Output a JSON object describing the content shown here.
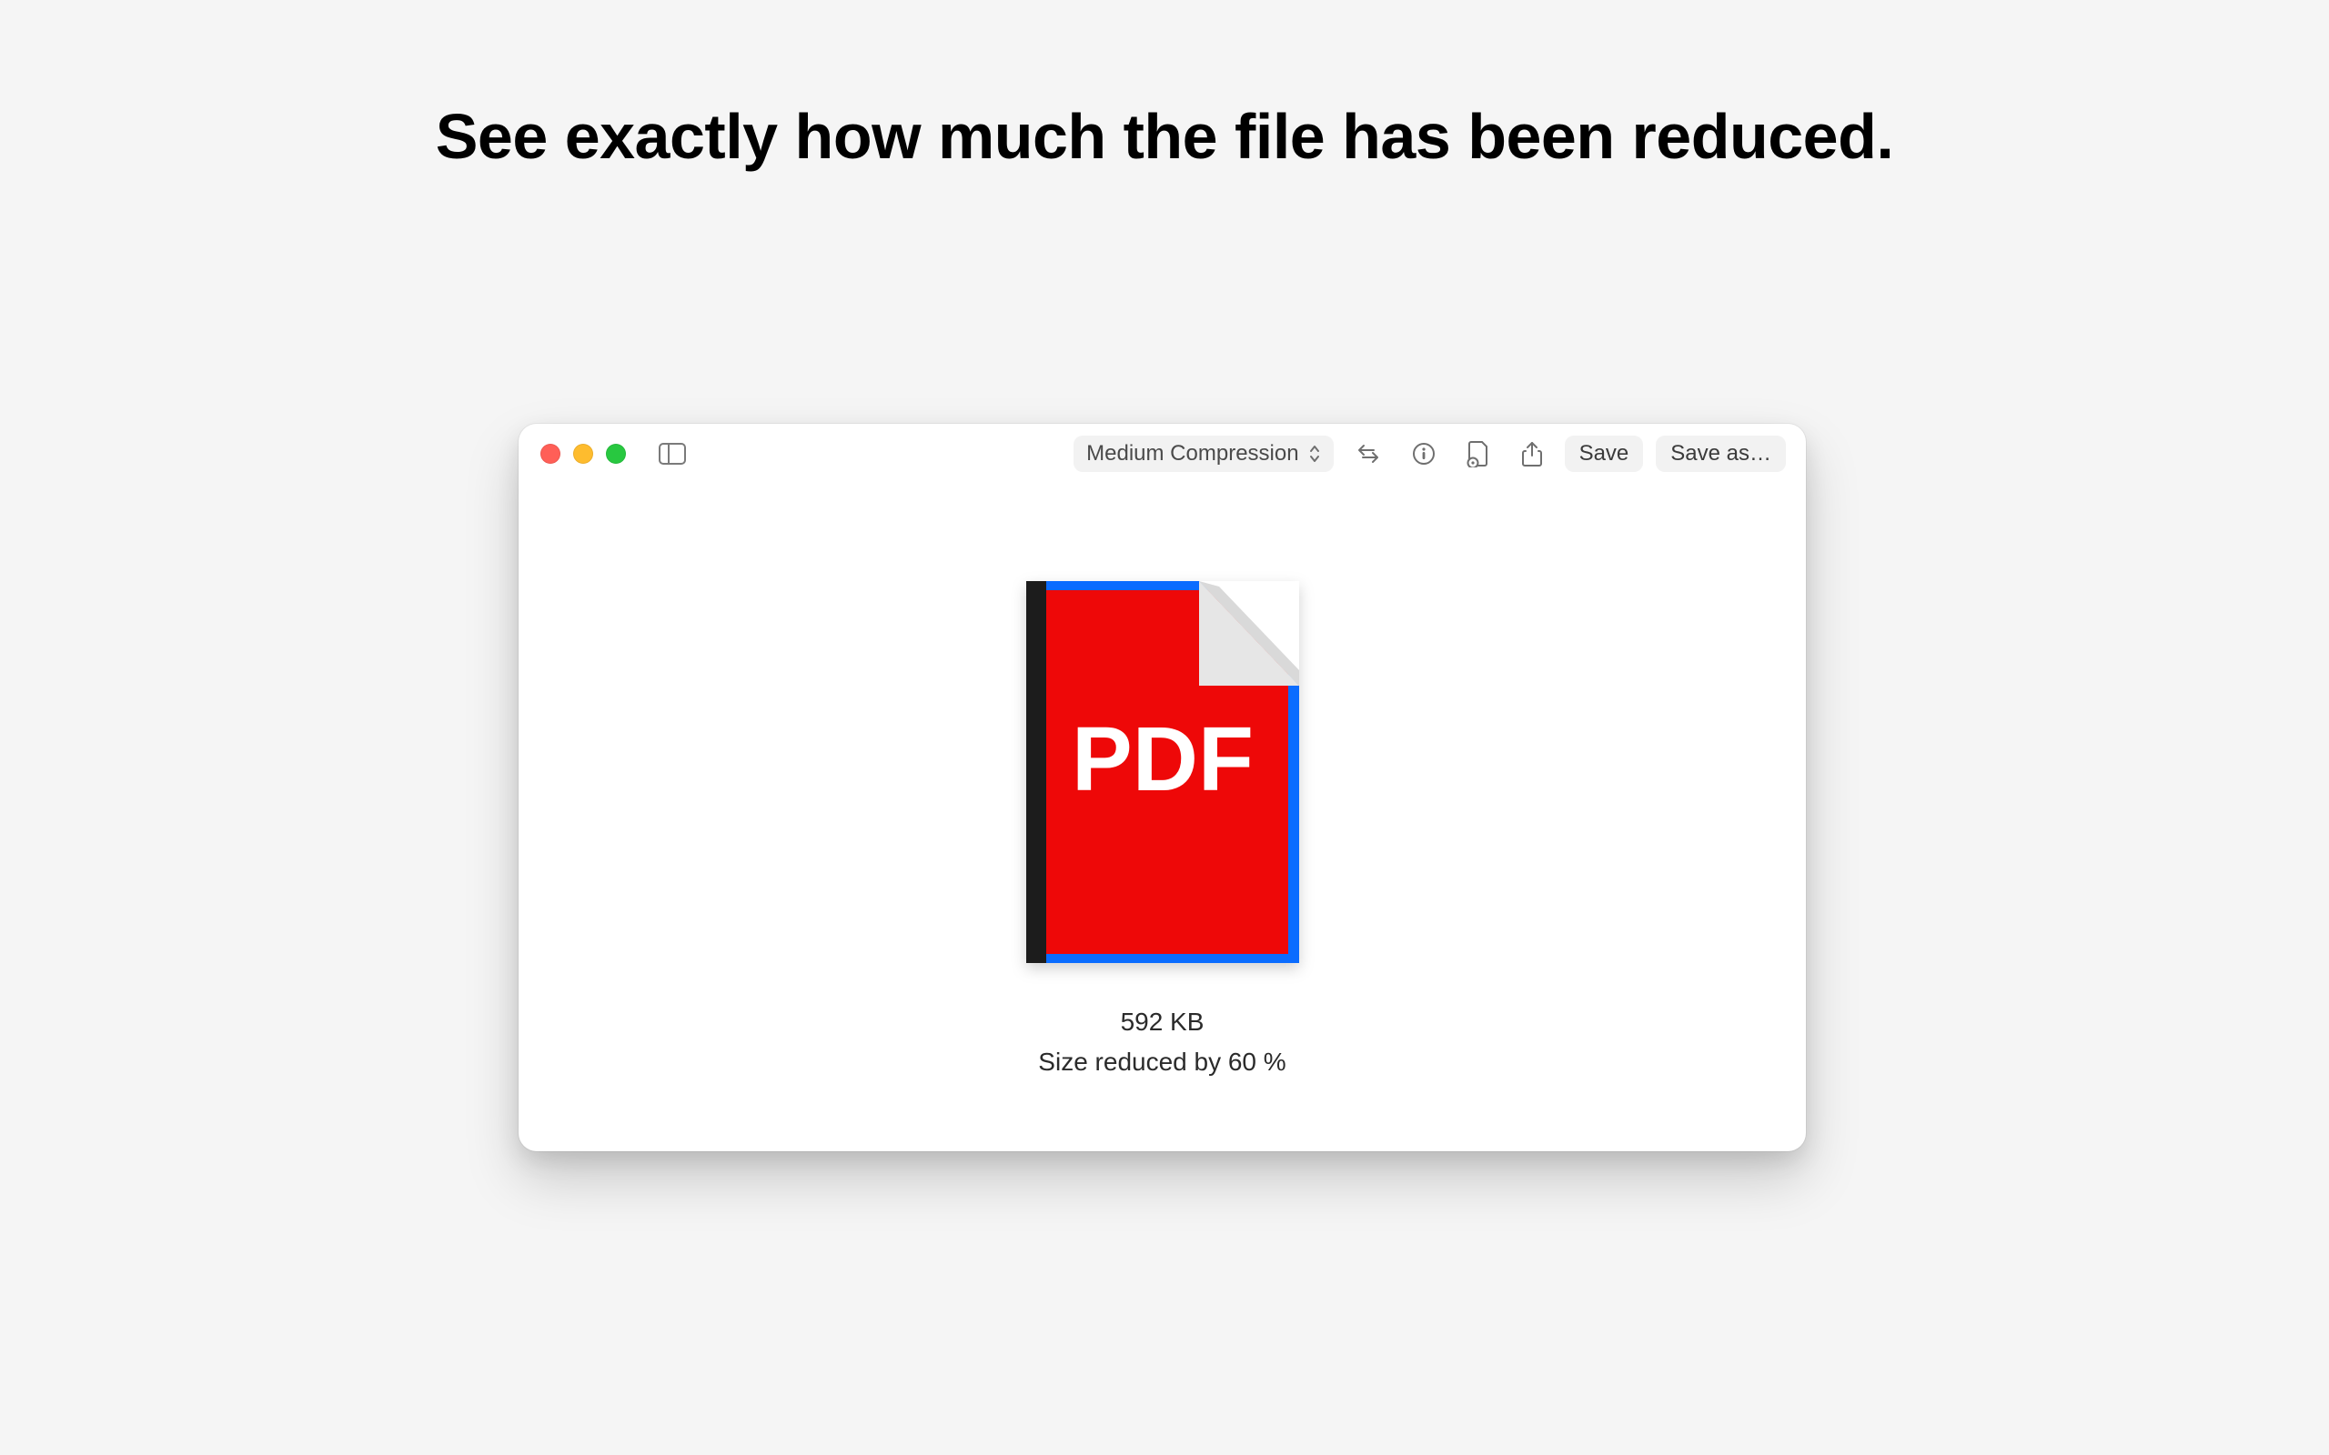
{
  "headline": "See exactly how much the file has been reduced.",
  "toolbar": {
    "compression_label": "Medium Compression",
    "save_label": "Save",
    "save_as_label": "Save as…"
  },
  "file": {
    "icon_text": "PDF",
    "size_label": "592 KB",
    "reduction_label": "Size reduced by 60 %"
  },
  "colors": {
    "pdf_red": "#ee0808",
    "pdf_blue": "#0a6cff",
    "spine": "#1c1c1c"
  }
}
